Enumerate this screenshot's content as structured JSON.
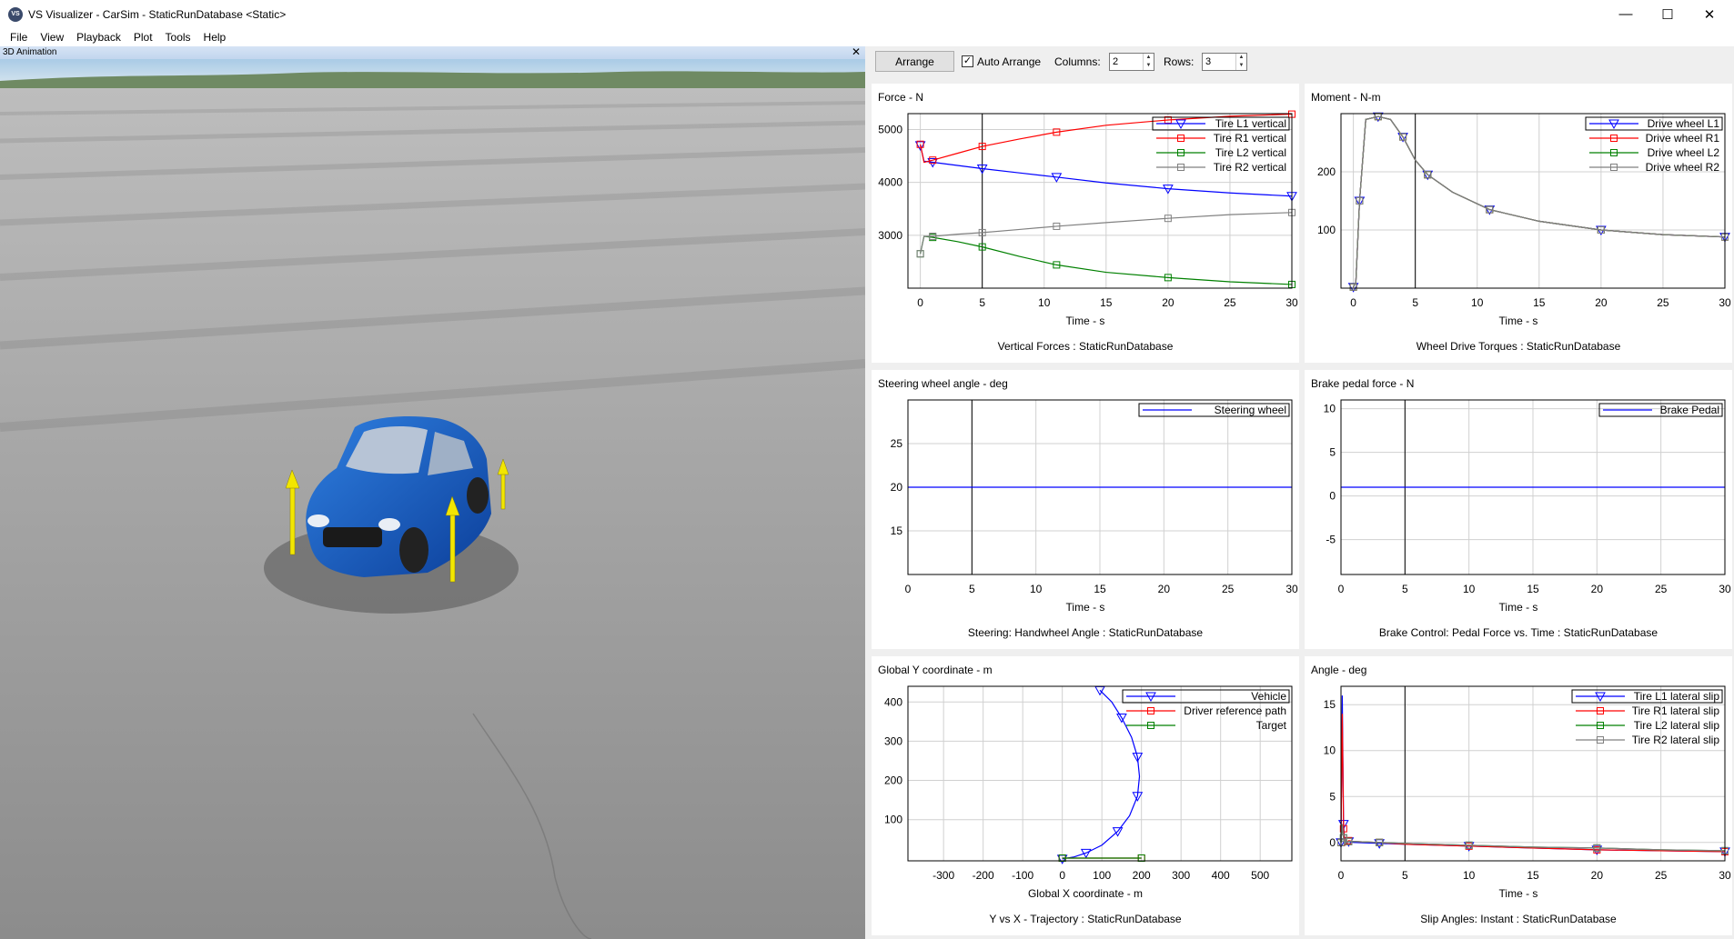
{
  "window": {
    "title": "VS Visualizer - CarSim - StaticRunDatabase <Static>",
    "minimize": "—",
    "maximize": "☐",
    "close": "✕"
  },
  "menu": [
    "File",
    "View",
    "Playback",
    "Plot",
    "Tools",
    "Help"
  ],
  "animation": {
    "header": "3D Animation",
    "close": "✕"
  },
  "toolbar": {
    "arrange_label": "Arrange",
    "auto_arrange_label": "Auto Arrange",
    "auto_arrange_checked": "✓",
    "columns_label": "Columns:",
    "columns_value": "2",
    "rows_label": "Rows:",
    "rows_value": "3"
  },
  "plots": [
    {
      "ylabel": "Force - N",
      "xlabel": "Time - s",
      "caption": "Vertical Forces : StaticRunDatabase",
      "chart_data": {
        "type": "line",
        "xlim": [
          -1,
          30
        ],
        "ylim": [
          2000,
          5300
        ],
        "xticks": [
          0,
          5,
          10,
          15,
          20,
          25,
          30
        ],
        "yticks": [
          3000,
          4000,
          5000
        ],
        "cursor_x": 5,
        "legend": "top-right",
        "series": [
          {
            "name": "Tire L1 vertical",
            "color": "#0000ff",
            "marker": "tri",
            "x": [
              0,
              0.3,
              1,
              3,
              5,
              8,
              11,
              15,
              20,
              25,
              30
            ],
            "y": [
              4700,
              4400,
              4380,
              4320,
              4260,
              4180,
              4100,
              3990,
              3880,
              3800,
              3740
            ]
          },
          {
            "name": "Tire R1 vertical",
            "color": "#ff0000",
            "marker": "sq",
            "x": [
              0,
              0.3,
              1,
              3,
              5,
              8,
              11,
              15,
              20,
              25,
              30
            ],
            "y": [
              4720,
              4380,
              4420,
              4550,
              4680,
              4820,
              4950,
              5080,
              5180,
              5250,
              5290
            ]
          },
          {
            "name": "Tire L2 vertical",
            "color": "#008000",
            "marker": "sq",
            "x": [
              0,
              0.3,
              1,
              3,
              5,
              8,
              11,
              15,
              20,
              25,
              30
            ],
            "y": [
              2650,
              2980,
              2960,
              2880,
              2780,
              2600,
              2440,
              2300,
              2200,
              2120,
              2070
            ]
          },
          {
            "name": "Tire R2 vertical",
            "color": "#808080",
            "marker": "sq",
            "x": [
              0,
              0.3,
              1,
              3,
              5,
              8,
              11,
              15,
              20,
              25,
              30
            ],
            "y": [
              2650,
              2980,
              2980,
              3020,
              3050,
              3110,
              3170,
              3240,
              3320,
              3390,
              3430
            ]
          }
        ]
      }
    },
    {
      "ylabel": "Moment - N-m",
      "xlabel": "Time - s",
      "caption": "Wheel Drive Torques : StaticRunDatabase",
      "chart_data": {
        "type": "line",
        "xlim": [
          -1,
          30
        ],
        "ylim": [
          0,
          300
        ],
        "xticks": [
          0,
          5,
          10,
          15,
          20,
          25,
          30
        ],
        "yticks": [
          100,
          200
        ],
        "cursor_x": 5,
        "legend": "top-right",
        "series": [
          {
            "name": "Drive wheel L1",
            "color": "#0000ff",
            "marker": "tri",
            "x": [
              0,
              0.2,
              0.5,
              1,
              2,
              3,
              4,
              5,
              6,
              8,
              11,
              15,
              20,
              25,
              30
            ],
            "y": [
              2,
              10,
              150,
              290,
              295,
              290,
              260,
              220,
              195,
              165,
              135,
              115,
              100,
              92,
              88
            ]
          },
          {
            "name": "Drive wheel R1",
            "color": "#ff0000",
            "marker": "sq",
            "x": [
              0,
              0.2,
              0.5,
              1,
              2,
              3,
              4,
              5,
              6,
              8,
              11,
              15,
              20,
              25,
              30
            ],
            "y": [
              2,
              10,
              150,
              290,
              295,
              290,
              260,
              220,
              195,
              165,
              135,
              115,
              100,
              92,
              88
            ]
          },
          {
            "name": "Drive wheel L2",
            "color": "#008000",
            "marker": "sq",
            "x": [
              0,
              0.2,
              0.5,
              1,
              2,
              3,
              4,
              5,
              6,
              8,
              11,
              15,
              20,
              25,
              30
            ],
            "y": [
              2,
              10,
              150,
              290,
              295,
              290,
              260,
              220,
              195,
              165,
              135,
              115,
              100,
              92,
              88
            ]
          },
          {
            "name": "Drive wheel R2",
            "color": "#808080",
            "marker": "sq",
            "x": [
              0,
              0.2,
              0.5,
              1,
              2,
              3,
              4,
              5,
              6,
              8,
              11,
              15,
              20,
              25,
              30
            ],
            "y": [
              2,
              10,
              150,
              290,
              295,
              290,
              260,
              220,
              195,
              165,
              135,
              115,
              100,
              92,
              88
            ]
          }
        ]
      }
    },
    {
      "ylabel": "Steering wheel angle - deg",
      "xlabel": "Time - s",
      "caption": "Steering: Handwheel Angle : StaticRunDatabase",
      "chart_data": {
        "type": "line",
        "xlim": [
          0,
          30
        ],
        "ylim": [
          10,
          30
        ],
        "xticks": [
          0,
          5,
          10,
          15,
          20,
          25,
          30
        ],
        "yticks": [
          15,
          20,
          25
        ],
        "cursor_x": 5,
        "legend": "top-right",
        "series": [
          {
            "name": "Steering wheel",
            "color": "#0000ff",
            "marker": "none",
            "x": [
              0,
              30
            ],
            "y": [
              20,
              20
            ]
          }
        ]
      }
    },
    {
      "ylabel": "Brake pedal force - N",
      "xlabel": "Time - s",
      "caption": "Brake Control: Pedal Force vs. Time : StaticRunDatabase",
      "chart_data": {
        "type": "line",
        "xlim": [
          0,
          30
        ],
        "ylim": [
          -9,
          11
        ],
        "xticks": [
          0,
          5,
          10,
          15,
          20,
          25,
          30
        ],
        "yticks": [
          -5,
          0,
          5,
          10
        ],
        "cursor_x": 5,
        "legend": "top-right",
        "series": [
          {
            "name": "Brake Pedal",
            "color": "#0000ff",
            "marker": "none",
            "x": [
              0,
              30
            ],
            "y": [
              1,
              1
            ]
          }
        ]
      }
    },
    {
      "ylabel": "Global Y coordinate - m",
      "xlabel": "Global X coordinate - m",
      "caption": "Y vs X - Trajectory : StaticRunDatabase",
      "chart_data": {
        "type": "line",
        "xlim": [
          -390,
          580
        ],
        "ylim": [
          -5,
          440
        ],
        "xticks": [
          -300,
          -200,
          -100,
          0,
          100,
          200,
          300,
          400,
          500
        ],
        "yticks": [
          100,
          200,
          300,
          400
        ],
        "cursor_x": null,
        "legend": "top-right",
        "series": [
          {
            "name": "Vehicle",
            "color": "#0000ff",
            "marker": "tri",
            "x": [
              0,
              30,
              60,
              100,
              140,
              170,
              190,
              195,
              190,
              175,
              150,
              125,
              95
            ],
            "y": [
              0,
              5,
              15,
              35,
              70,
              110,
              160,
              210,
              260,
              310,
              360,
              400,
              430
            ]
          },
          {
            "name": "Driver reference path",
            "color": "#ff0000",
            "marker": "sq",
            "x": [
              0,
              200
            ],
            "y": [
              2,
              2
            ]
          },
          {
            "name": "Target",
            "color": "#008000",
            "marker": "sq",
            "x": [
              0,
              200
            ],
            "y": [
              2,
              2
            ]
          }
        ]
      }
    },
    {
      "ylabel": "Angle - deg",
      "xlabel": "Time - s",
      "caption": "Slip Angles: Instant : StaticRunDatabase",
      "chart_data": {
        "type": "line",
        "xlim": [
          0,
          30
        ],
        "ylim": [
          -2,
          17
        ],
        "xticks": [
          0,
          5,
          10,
          15,
          20,
          25,
          30
        ],
        "yticks": [
          0,
          5,
          10,
          15
        ],
        "cursor_x": 5,
        "legend": "top-right",
        "series": [
          {
            "name": "Tire L1 lateral slip",
            "color": "#0000ff",
            "marker": "tri",
            "x": [
              0,
              0.1,
              0.2,
              0.3,
              0.6,
              1,
              3,
              5,
              10,
              15,
              20,
              25,
              30
            ],
            "y": [
              0,
              16,
              2,
              -0.2,
              0.1,
              0,
              -0.1,
              -0.2,
              -0.4,
              -0.6,
              -0.8,
              -0.9,
              -1.0
            ]
          },
          {
            "name": "Tire R1 lateral slip",
            "color": "#ff0000",
            "marker": "sq",
            "x": [
              0,
              0.1,
              0.2,
              0.3,
              0.6,
              1,
              3,
              5,
              10,
              15,
              20,
              25,
              30
            ],
            "y": [
              0,
              14,
              1.5,
              -0.3,
              0.2,
              0.1,
              0,
              -0.2,
              -0.4,
              -0.6,
              -0.8,
              -0.9,
              -1.0
            ]
          },
          {
            "name": "Tire L2 lateral slip",
            "color": "#008000",
            "marker": "sq",
            "x": [
              0,
              0.1,
              0.2,
              0.3,
              0.6,
              1,
              3,
              5,
              10,
              15,
              20,
              25,
              30
            ],
            "y": [
              0,
              2,
              0.5,
              -0.1,
              0.1,
              0.1,
              0,
              -0.1,
              -0.3,
              -0.5,
              -0.6,
              -0.8,
              -0.9
            ]
          },
          {
            "name": "Tire R2 lateral slip",
            "color": "#808080",
            "marker": "sq",
            "x": [
              0,
              0.1,
              0.2,
              0.3,
              0.6,
              1,
              3,
              5,
              10,
              15,
              20,
              25,
              30
            ],
            "y": [
              0,
              2,
              0.5,
              -0.1,
              0.1,
              0.1,
              0,
              -0.1,
              -0.3,
              -0.5,
              -0.6,
              -0.8,
              -0.9
            ]
          }
        ]
      }
    }
  ]
}
